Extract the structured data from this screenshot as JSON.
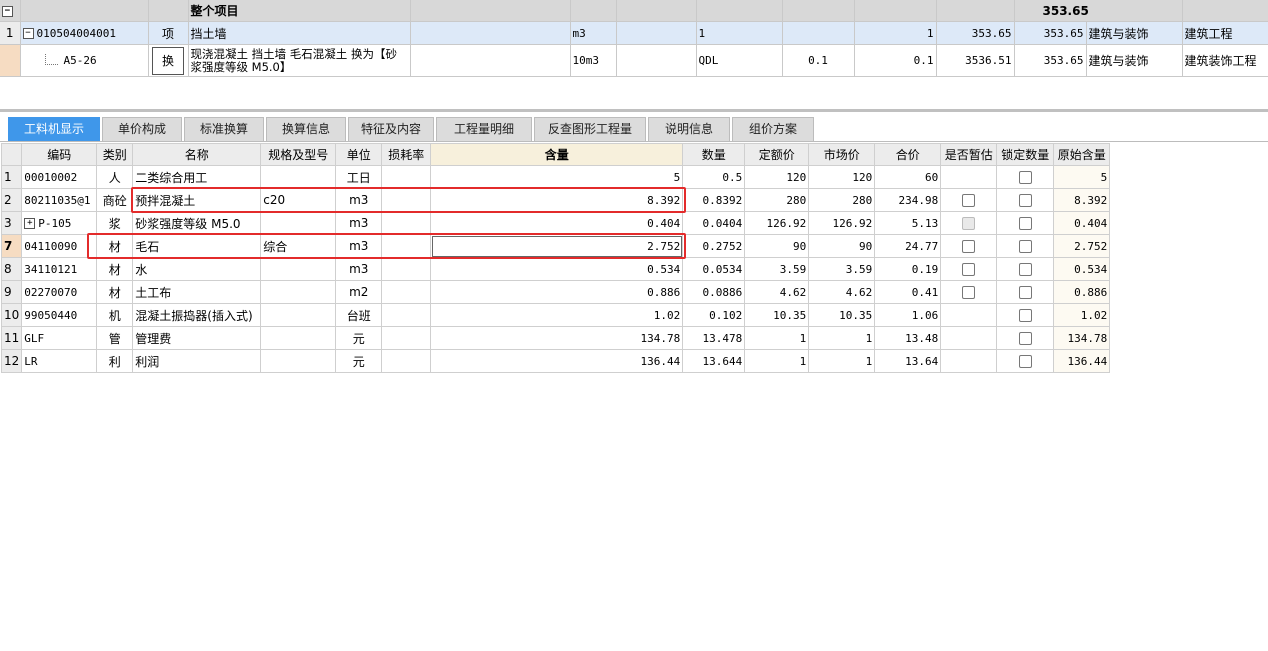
{
  "top_grid": {
    "project_row": {
      "label": "整个项目",
      "total": "353.65"
    },
    "item_row": {
      "row_no": "1",
      "code": "010504004001",
      "type": "项",
      "name": "挡土墙",
      "unit": "m3",
      "expr": "1",
      "qty": "1",
      "unit_price": "353.65",
      "total": "353.65",
      "category": "建筑与装饰",
      "specialty": "建筑工程"
    },
    "quota_row": {
      "code": "A5-26",
      "type": "换",
      "name": "现浇混凝土 挡土墙 毛石混凝土  换为【砂浆强度等级 M5.0】",
      "unit": "10m3",
      "expr": "QDL",
      "factor": "0.1",
      "qty": "0.1",
      "unit_price": "3536.51",
      "total": "353.65",
      "category": "建筑与装饰",
      "specialty": "建筑装饰工程"
    }
  },
  "tabs": [
    {
      "label": "工料机显示",
      "active": true
    },
    {
      "label": "单价构成"
    },
    {
      "label": "标准换算"
    },
    {
      "label": "换算信息"
    },
    {
      "label": "特征及内容"
    },
    {
      "label": "工程量明细"
    },
    {
      "label": "反查图形工程量"
    },
    {
      "label": "说明信息"
    },
    {
      "label": "组价方案"
    }
  ],
  "detail_grid": {
    "headers": [
      "编码",
      "类别",
      "名称",
      "规格及型号",
      "单位",
      "损耗率",
      "含量",
      "数量",
      "定额价",
      "市场价",
      "合价",
      "是否暂估",
      "锁定数量",
      "原始含量"
    ],
    "rows": [
      {
        "no": "1",
        "code": "00010002",
        "cat": "人",
        "name": "二类综合用工",
        "spec": "",
        "unit": "工日",
        "loss": "",
        "content": "5",
        "qty": "0.5",
        "quota": "120",
        "market": "120",
        "total": "60",
        "est": "none",
        "lock": "box",
        "orig": "5"
      },
      {
        "no": "2",
        "code": "80211035@1",
        "cat": "商砼",
        "name": "预拌混凝土",
        "spec": "c20",
        "unit": "m3",
        "loss": "",
        "content": "8.392",
        "qty": "0.8392",
        "quota": "280",
        "market": "280",
        "total": "234.98",
        "est": "box",
        "lock": "box",
        "orig": "8.392"
      },
      {
        "no": "3",
        "code": "P-105",
        "cat": "浆",
        "name": "砂浆强度等级 M5.0",
        "spec": "",
        "unit": "m3",
        "loss": "",
        "content": "0.404",
        "qty": "0.0404",
        "quota": "126.92",
        "market": "126.92",
        "total": "5.13",
        "est": "disabled",
        "lock": "box",
        "orig": "0.404",
        "expand": "+"
      },
      {
        "no": "7",
        "code": "04110090",
        "cat": "材",
        "name": "毛石",
        "spec": "综合",
        "unit": "m3",
        "loss": "",
        "content": "2.752",
        "qty": "0.2752",
        "quota": "90",
        "market": "90",
        "total": "24.77",
        "est": "box",
        "lock": "box",
        "orig": "2.752",
        "selected": true
      },
      {
        "no": "8",
        "code": "34110121",
        "cat": "材",
        "name": "水",
        "spec": "",
        "unit": "m3",
        "loss": "",
        "content": "0.534",
        "qty": "0.0534",
        "quota": "3.59",
        "market": "3.59",
        "total": "0.19",
        "est": "box",
        "lock": "box",
        "orig": "0.534"
      },
      {
        "no": "9",
        "code": "02270070",
        "cat": "材",
        "name": "土工布",
        "spec": "",
        "unit": "m2",
        "loss": "",
        "content": "0.886",
        "qty": "0.0886",
        "quota": "4.62",
        "market": "4.62",
        "total": "0.41",
        "est": "box",
        "lock": "box",
        "orig": "0.886"
      },
      {
        "no": "10",
        "code": "99050440",
        "cat": "机",
        "name": "混凝土振捣器(插入式)",
        "spec": "",
        "unit": "台班",
        "loss": "",
        "content": "1.02",
        "qty": "0.102",
        "quota": "10.35",
        "market": "10.35",
        "total": "1.06",
        "est": "none",
        "lock": "box",
        "orig": "1.02"
      },
      {
        "no": "11",
        "code": "GLF",
        "cat": "管",
        "name": "管理费",
        "spec": "",
        "unit": "元",
        "loss": "",
        "content": "134.78",
        "qty": "13.478",
        "quota": "1",
        "market": "1",
        "total": "13.48",
        "est": "none",
        "lock": "box",
        "orig": "134.78"
      },
      {
        "no": "12",
        "code": "LR",
        "cat": "利",
        "name": "利润",
        "spec": "",
        "unit": "元",
        "loss": "",
        "content": "136.44",
        "qty": "13.644",
        "quota": "1",
        "market": "1",
        "total": "13.64",
        "est": "none",
        "lock": "box",
        "orig": "136.44"
      }
    ]
  },
  "colors": {
    "tab_active": "#3f97ea",
    "highlight_border": "#e32b2b",
    "selected_row_no": "#f6dcc2"
  }
}
